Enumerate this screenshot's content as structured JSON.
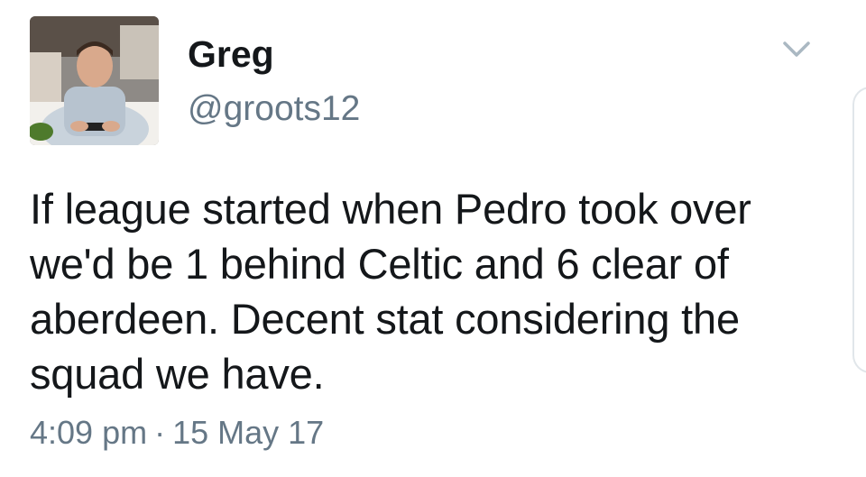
{
  "author": {
    "name": "Greg",
    "handle": "@groots12"
  },
  "tweet": {
    "text": "If league started when Pedro took over we'd be 1 behind Celtic and 6 clear of aberdeen. Decent stat considering the squad we have.",
    "time": "4:09 pm",
    "separator": "·",
    "date": "15 May 17"
  },
  "icons": {
    "menu": "chevron-down-icon"
  },
  "colors": {
    "text": "#14171a",
    "secondary": "#657786"
  }
}
